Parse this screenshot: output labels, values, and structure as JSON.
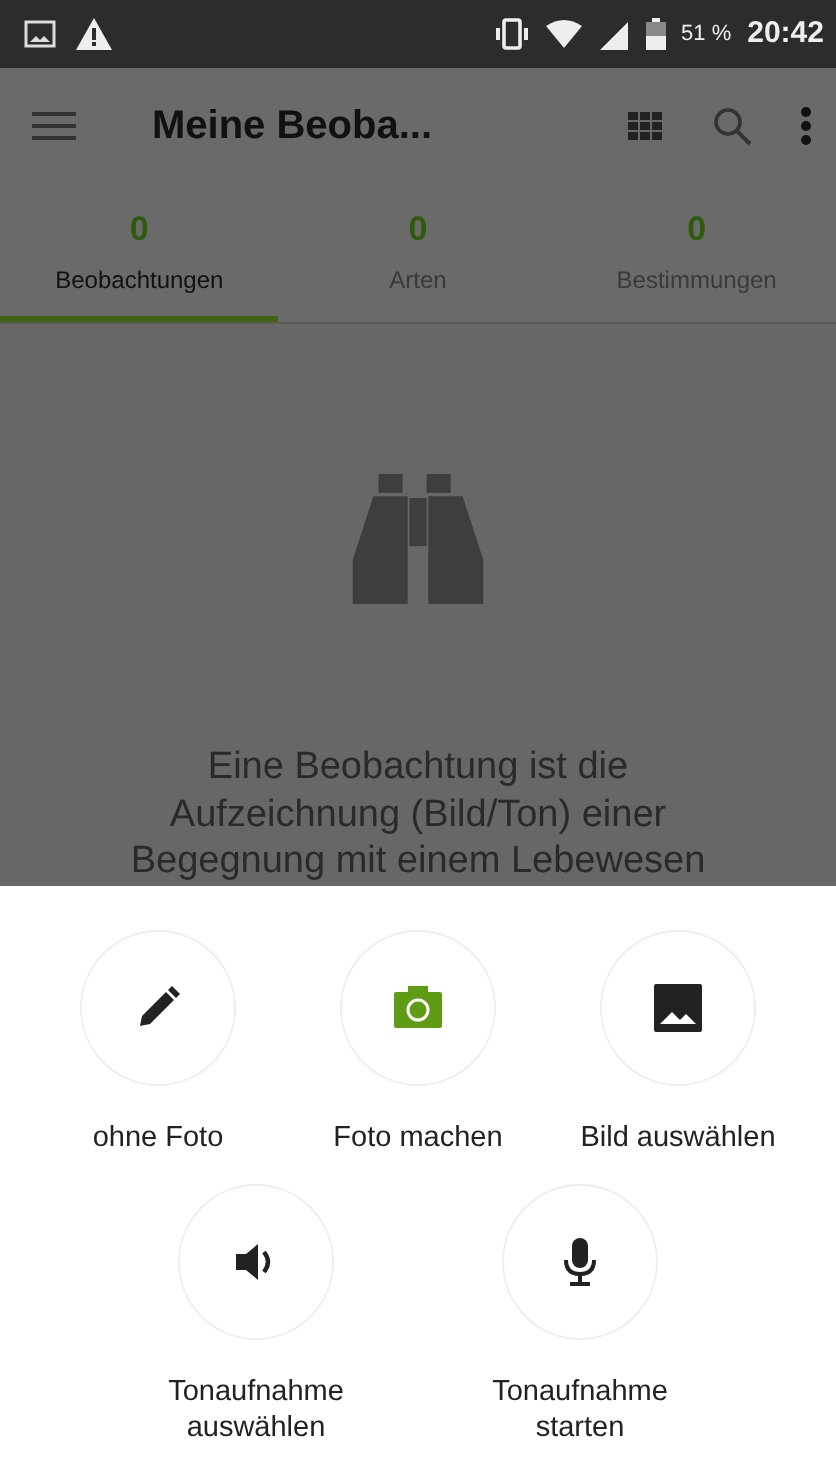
{
  "status_bar": {
    "battery": "51 %",
    "time": "20:42"
  },
  "app_bar": {
    "title": "Meine Beoba..."
  },
  "tabs": [
    {
      "count": "0",
      "label": "Beobachtungen",
      "selected": true
    },
    {
      "count": "0",
      "label": "Arten",
      "selected": false
    },
    {
      "count": "0",
      "label": "Bestimmungen",
      "selected": false
    }
  ],
  "empty_state": {
    "text": "Eine Beobachtung ist die Aufzeichnung (Bild/Ton) einer Begegnung mit einem Lebewesen"
  },
  "sheet": {
    "rows": [
      [
        {
          "kind": "pencil",
          "label": "ohne Foto"
        },
        {
          "kind": "camera",
          "label": "Foto machen"
        },
        {
          "kind": "image",
          "label": "Bild auswählen"
        }
      ],
      [
        {
          "kind": "speaker",
          "label": "Tonaufnahme auswählen"
        },
        {
          "kind": "mic",
          "label": "Tonaufnahme starten"
        }
      ]
    ]
  }
}
